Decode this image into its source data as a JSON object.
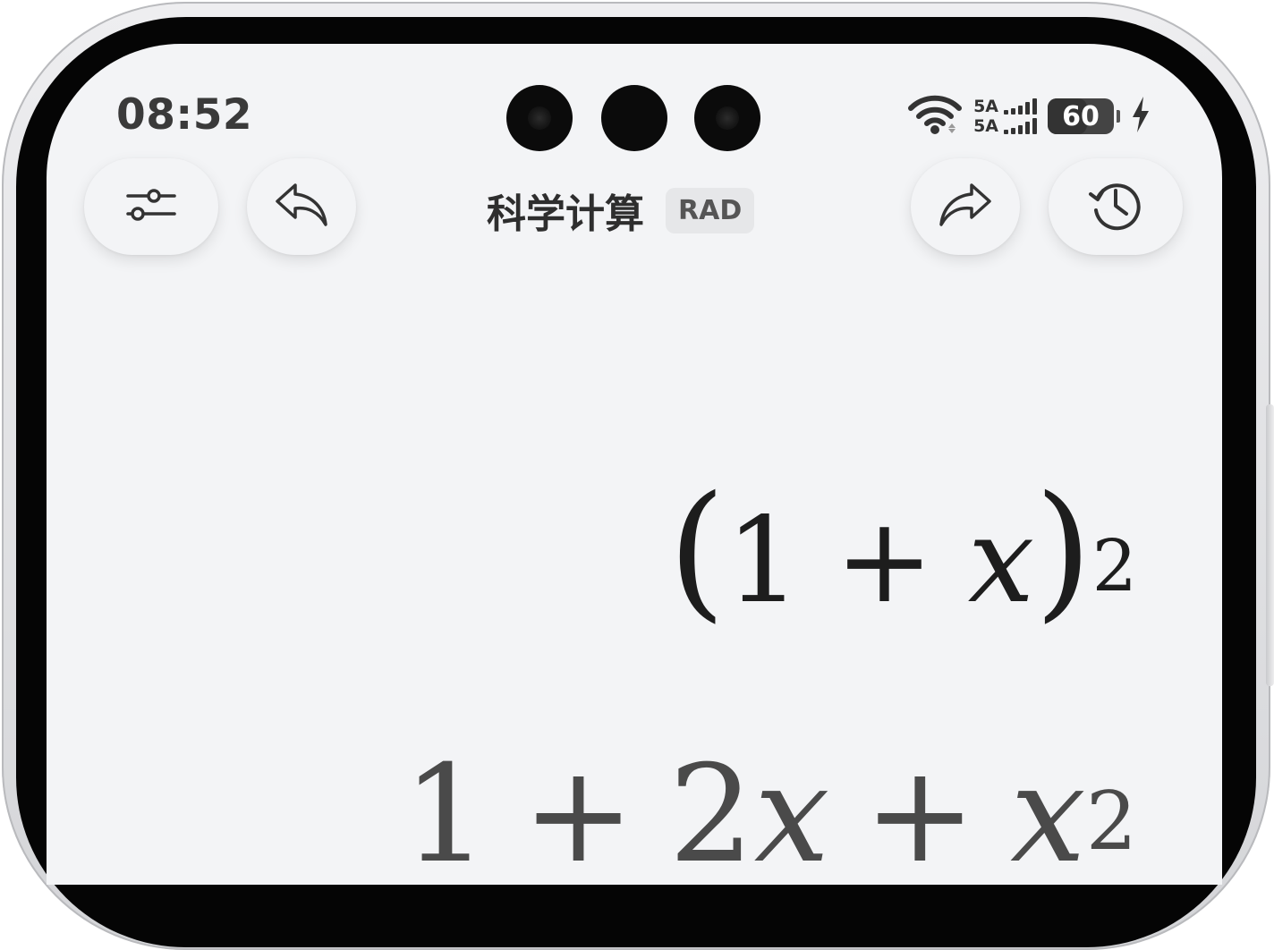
{
  "status_bar": {
    "time": "08:52",
    "network_label_1": "5A",
    "network_label_2": "5A",
    "battery_percent": "60",
    "battery_level": 0.6,
    "icons": [
      "wifi-icon",
      "signal-icon",
      "battery-icon",
      "charging-bolt-icon"
    ]
  },
  "header": {
    "title": "科学计算",
    "angle_mode": "RAD",
    "left_buttons": [
      "settings-sliders-icon",
      "undo-icon"
    ],
    "right_buttons": [
      "redo-icon",
      "history-icon"
    ]
  },
  "display": {
    "expression": {
      "open_paren": "(",
      "a": "1",
      "op": "+",
      "var": "x",
      "close_paren": ")",
      "exponent": "2"
    },
    "result": {
      "t1": "1",
      "op1": "+",
      "coef": "2",
      "var1": "x",
      "op2": "+",
      "var2": "x",
      "exponent": "2"
    }
  },
  "colors": {
    "screen_bg": "#f3f4f6",
    "text_primary": "#2e2e2e",
    "result_text": "#4a4a4a"
  }
}
